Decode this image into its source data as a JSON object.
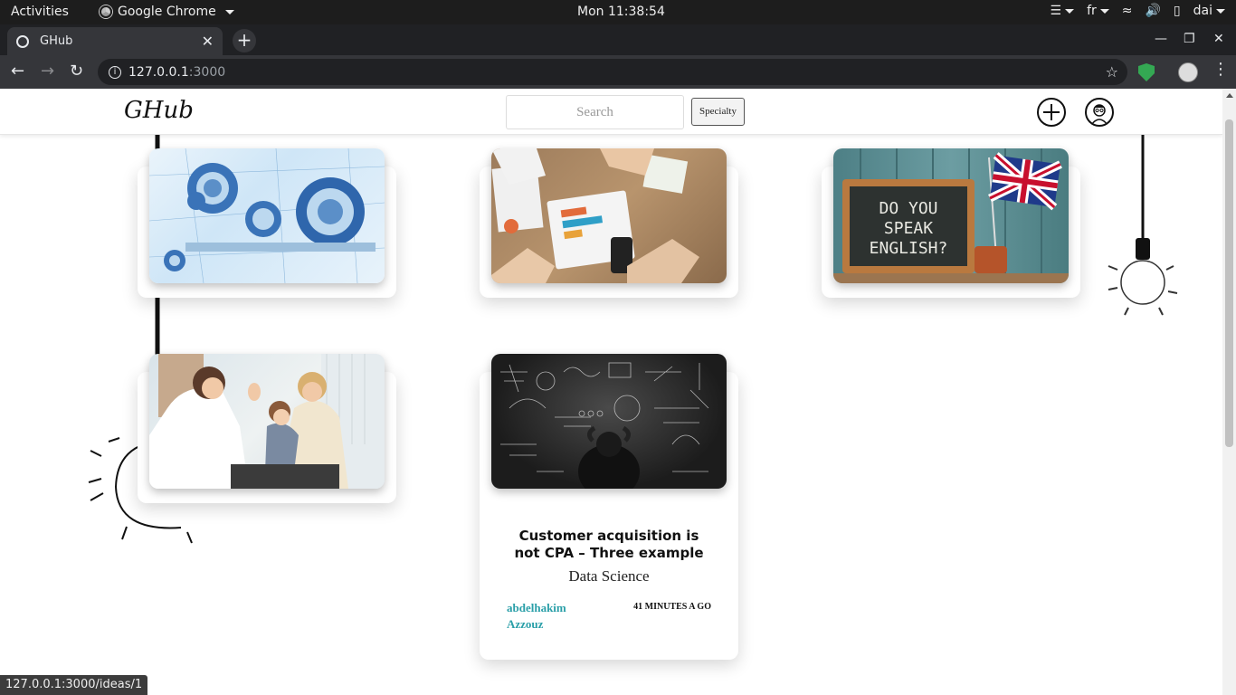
{
  "gnome_bar": {
    "activities": "Activities",
    "app_name": "Google Chrome",
    "clock": "Mon 11:38:54",
    "keyboard_layout": "fr",
    "user": "dai"
  },
  "browser": {
    "tab_title": "GHub",
    "url_host": "127.0.0.1",
    "url_port": ":3000",
    "status_url": "127.0.0.1:3000/ideas/1"
  },
  "site": {
    "logo": "GHub",
    "search_placeholder": "Search",
    "specialty_label": "Specialty"
  },
  "ideas": [
    {
      "image": "bearings-blueprint"
    },
    {
      "image": "crisis-management-plan-meeting"
    },
    {
      "image": "do-you-speak-english-chalkboard"
    },
    {
      "image": "doctor-child-high-five"
    },
    {
      "image": "math-chalkboard-thinker",
      "title": "Customer acquisition is not CPA – Three example",
      "specialty": "Data Science",
      "author": "abdelhakim Azzouz",
      "time": "41 MINUTES A GO"
    }
  ]
}
